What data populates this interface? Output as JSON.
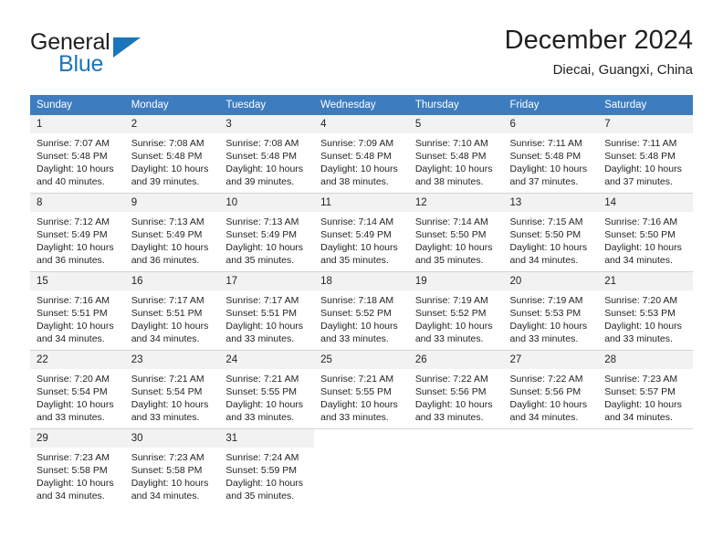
{
  "brand": {
    "name_part1": "General",
    "name_part2": "Blue",
    "logo_icon": "triangle-flag-icon",
    "color_primary": "#1b75bb",
    "color_text": "#231f20"
  },
  "header": {
    "title": "December 2024",
    "subtitle": "Diecai, Guangxi, China"
  },
  "calendar": {
    "header_bg": "#3d7cbf",
    "daynum_bg": "#f2f2f2",
    "weekday_headers": [
      "Sunday",
      "Monday",
      "Tuesday",
      "Wednesday",
      "Thursday",
      "Friday",
      "Saturday"
    ],
    "weeks": [
      [
        {
          "day": "1",
          "sunrise": "Sunrise: 7:07 AM",
          "sunset": "Sunset: 5:48 PM",
          "daylight": "Daylight: 10 hours and 40 minutes."
        },
        {
          "day": "2",
          "sunrise": "Sunrise: 7:08 AM",
          "sunset": "Sunset: 5:48 PM",
          "daylight": "Daylight: 10 hours and 39 minutes."
        },
        {
          "day": "3",
          "sunrise": "Sunrise: 7:08 AM",
          "sunset": "Sunset: 5:48 PM",
          "daylight": "Daylight: 10 hours and 39 minutes."
        },
        {
          "day": "4",
          "sunrise": "Sunrise: 7:09 AM",
          "sunset": "Sunset: 5:48 PM",
          "daylight": "Daylight: 10 hours and 38 minutes."
        },
        {
          "day": "5",
          "sunrise": "Sunrise: 7:10 AM",
          "sunset": "Sunset: 5:48 PM",
          "daylight": "Daylight: 10 hours and 38 minutes."
        },
        {
          "day": "6",
          "sunrise": "Sunrise: 7:11 AM",
          "sunset": "Sunset: 5:48 PM",
          "daylight": "Daylight: 10 hours and 37 minutes."
        },
        {
          "day": "7",
          "sunrise": "Sunrise: 7:11 AM",
          "sunset": "Sunset: 5:48 PM",
          "daylight": "Daylight: 10 hours and 37 minutes."
        }
      ],
      [
        {
          "day": "8",
          "sunrise": "Sunrise: 7:12 AM",
          "sunset": "Sunset: 5:49 PM",
          "daylight": "Daylight: 10 hours and 36 minutes."
        },
        {
          "day": "9",
          "sunrise": "Sunrise: 7:13 AM",
          "sunset": "Sunset: 5:49 PM",
          "daylight": "Daylight: 10 hours and 36 minutes."
        },
        {
          "day": "10",
          "sunrise": "Sunrise: 7:13 AM",
          "sunset": "Sunset: 5:49 PM",
          "daylight": "Daylight: 10 hours and 35 minutes."
        },
        {
          "day": "11",
          "sunrise": "Sunrise: 7:14 AM",
          "sunset": "Sunset: 5:49 PM",
          "daylight": "Daylight: 10 hours and 35 minutes."
        },
        {
          "day": "12",
          "sunrise": "Sunrise: 7:14 AM",
          "sunset": "Sunset: 5:50 PM",
          "daylight": "Daylight: 10 hours and 35 minutes."
        },
        {
          "day": "13",
          "sunrise": "Sunrise: 7:15 AM",
          "sunset": "Sunset: 5:50 PM",
          "daylight": "Daylight: 10 hours and 34 minutes."
        },
        {
          "day": "14",
          "sunrise": "Sunrise: 7:16 AM",
          "sunset": "Sunset: 5:50 PM",
          "daylight": "Daylight: 10 hours and 34 minutes."
        }
      ],
      [
        {
          "day": "15",
          "sunrise": "Sunrise: 7:16 AM",
          "sunset": "Sunset: 5:51 PM",
          "daylight": "Daylight: 10 hours and 34 minutes."
        },
        {
          "day": "16",
          "sunrise": "Sunrise: 7:17 AM",
          "sunset": "Sunset: 5:51 PM",
          "daylight": "Daylight: 10 hours and 34 minutes."
        },
        {
          "day": "17",
          "sunrise": "Sunrise: 7:17 AM",
          "sunset": "Sunset: 5:51 PM",
          "daylight": "Daylight: 10 hours and 33 minutes."
        },
        {
          "day": "18",
          "sunrise": "Sunrise: 7:18 AM",
          "sunset": "Sunset: 5:52 PM",
          "daylight": "Daylight: 10 hours and 33 minutes."
        },
        {
          "day": "19",
          "sunrise": "Sunrise: 7:19 AM",
          "sunset": "Sunset: 5:52 PM",
          "daylight": "Daylight: 10 hours and 33 minutes."
        },
        {
          "day": "20",
          "sunrise": "Sunrise: 7:19 AM",
          "sunset": "Sunset: 5:53 PM",
          "daylight": "Daylight: 10 hours and 33 minutes."
        },
        {
          "day": "21",
          "sunrise": "Sunrise: 7:20 AM",
          "sunset": "Sunset: 5:53 PM",
          "daylight": "Daylight: 10 hours and 33 minutes."
        }
      ],
      [
        {
          "day": "22",
          "sunrise": "Sunrise: 7:20 AM",
          "sunset": "Sunset: 5:54 PM",
          "daylight": "Daylight: 10 hours and 33 minutes."
        },
        {
          "day": "23",
          "sunrise": "Sunrise: 7:21 AM",
          "sunset": "Sunset: 5:54 PM",
          "daylight": "Daylight: 10 hours and 33 minutes."
        },
        {
          "day": "24",
          "sunrise": "Sunrise: 7:21 AM",
          "sunset": "Sunset: 5:55 PM",
          "daylight": "Daylight: 10 hours and 33 minutes."
        },
        {
          "day": "25",
          "sunrise": "Sunrise: 7:21 AM",
          "sunset": "Sunset: 5:55 PM",
          "daylight": "Daylight: 10 hours and 33 minutes."
        },
        {
          "day": "26",
          "sunrise": "Sunrise: 7:22 AM",
          "sunset": "Sunset: 5:56 PM",
          "daylight": "Daylight: 10 hours and 33 minutes."
        },
        {
          "day": "27",
          "sunrise": "Sunrise: 7:22 AM",
          "sunset": "Sunset: 5:56 PM",
          "daylight": "Daylight: 10 hours and 34 minutes."
        },
        {
          "day": "28",
          "sunrise": "Sunrise: 7:23 AM",
          "sunset": "Sunset: 5:57 PM",
          "daylight": "Daylight: 10 hours and 34 minutes."
        }
      ],
      [
        {
          "day": "29",
          "sunrise": "Sunrise: 7:23 AM",
          "sunset": "Sunset: 5:58 PM",
          "daylight": "Daylight: 10 hours and 34 minutes."
        },
        {
          "day": "30",
          "sunrise": "Sunrise: 7:23 AM",
          "sunset": "Sunset: 5:58 PM",
          "daylight": "Daylight: 10 hours and 34 minutes."
        },
        {
          "day": "31",
          "sunrise": "Sunrise: 7:24 AM",
          "sunset": "Sunset: 5:59 PM",
          "daylight": "Daylight: 10 hours and 35 minutes."
        },
        {
          "day": "",
          "sunrise": "",
          "sunset": "",
          "daylight": ""
        },
        {
          "day": "",
          "sunrise": "",
          "sunset": "",
          "daylight": ""
        },
        {
          "day": "",
          "sunrise": "",
          "sunset": "",
          "daylight": ""
        },
        {
          "day": "",
          "sunrise": "",
          "sunset": "",
          "daylight": ""
        }
      ]
    ]
  }
}
